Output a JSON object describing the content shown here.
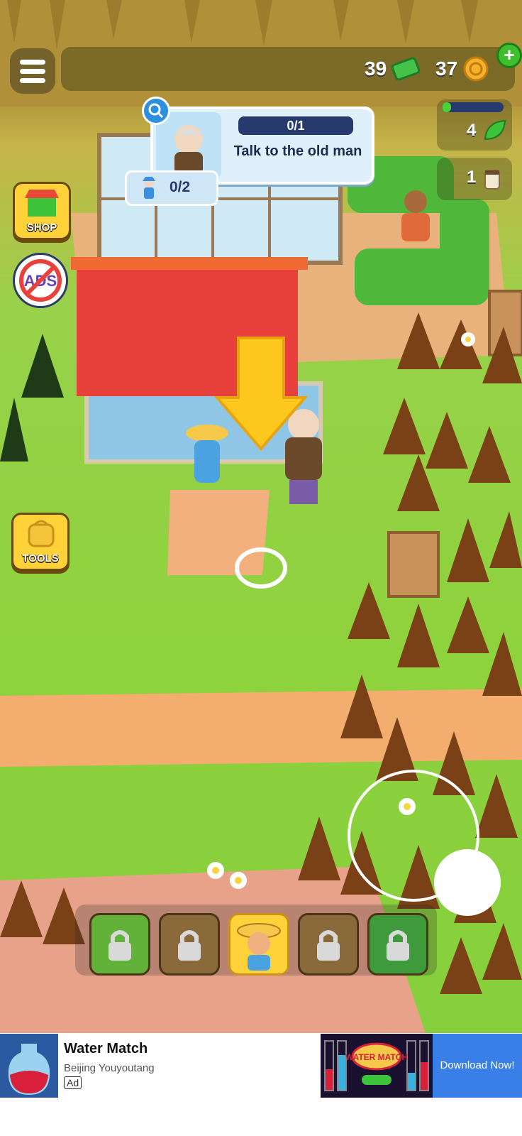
{
  "hud": {
    "cash_count": "39",
    "coin_count": "37",
    "plus_label": "+",
    "energy_count": "4",
    "energy_fill": 0.05,
    "cup_count": "1"
  },
  "quest": {
    "progress": "0/1",
    "text": "Talk to the old man",
    "scarecrow_progress": "0/2"
  },
  "left_buttons": {
    "shop_label": "SHOP",
    "ads_label": "ADS",
    "tools_label": "TOOLS"
  },
  "characters": [
    {
      "name": "locked-tools-character",
      "locked": true
    },
    {
      "name": "locked-cart-character",
      "locked": true
    },
    {
      "name": "farmer-character",
      "locked": false
    },
    {
      "name": "locked-couple-character",
      "locked": true
    },
    {
      "name": "locked-gardener-character",
      "locked": true
    }
  ],
  "ad": {
    "title": "Water Match",
    "subtitle": "Beijing Youyoutang",
    "tag": "Ad",
    "cta": "Download Now!",
    "brand_logo_text": "WATER MATCH"
  },
  "colors": {
    "grass": "#8fd23e",
    "path": "#f2a86a",
    "roof": "#e8403a",
    "arrow": "#ffc81e",
    "navy": "#263a6e"
  }
}
